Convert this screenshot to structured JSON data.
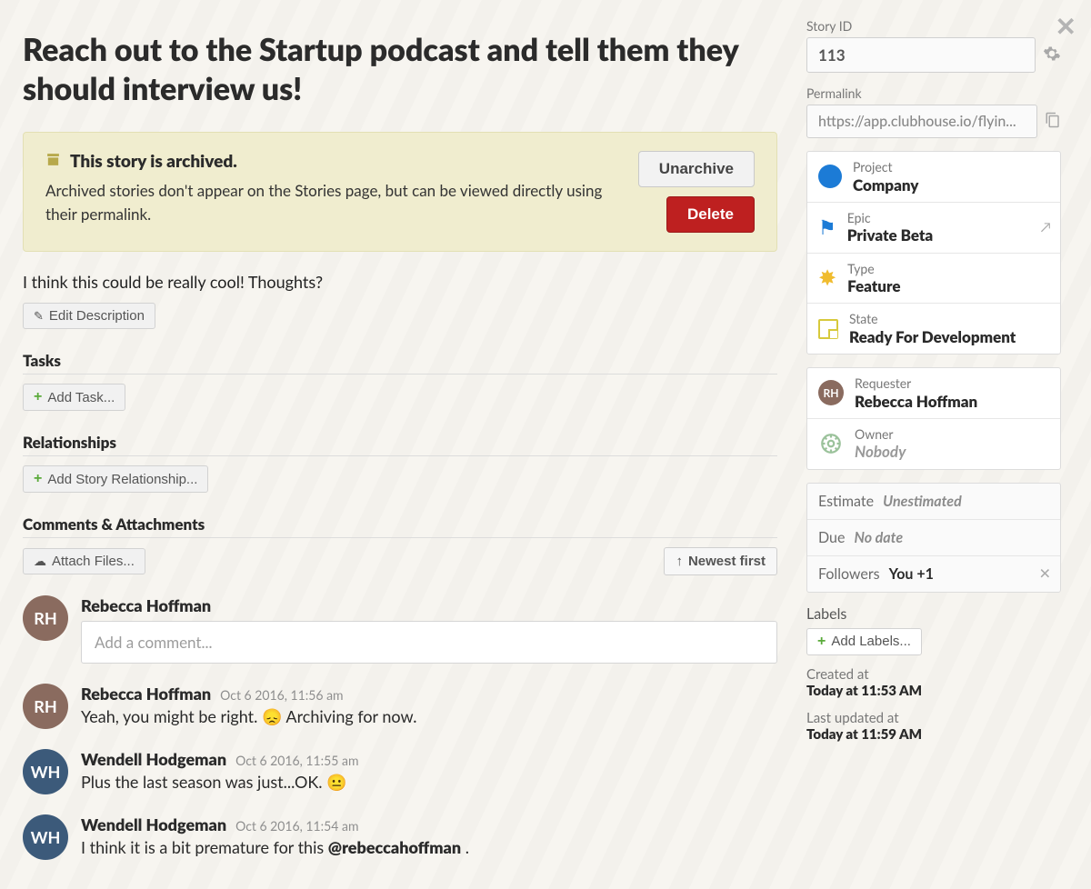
{
  "title": "Reach out to the Startup podcast and tell them they should interview us!",
  "archive": {
    "heading": "This story is archived.",
    "body": "Archived stories don't appear on the Stories page, but can be viewed directly using their permalink.",
    "unarchive_label": "Unarchive",
    "delete_label": "Delete"
  },
  "description": "I think this could be really cool! Thoughts?",
  "buttons": {
    "edit_description": "Edit Description",
    "add_task": "Add Task...",
    "add_relationship": "Add Story Relationship...",
    "attach_files": "Attach Files...",
    "sort": "Newest first",
    "add_labels": "Add Labels..."
  },
  "sections": {
    "tasks": "Tasks",
    "relationships": "Relationships",
    "comments": "Comments & Attachments",
    "labels": "Labels"
  },
  "composer": {
    "author": "Rebecca Hoffman",
    "placeholder": "Add a comment..."
  },
  "comments": [
    {
      "author": "Rebecca Hoffman",
      "timestamp": "Oct 6 2016, 11:56 am",
      "text_pre": "Yeah, you might be right. ",
      "emoji": "😞",
      "text_post": " Archiving for now.",
      "avatar": "woman"
    },
    {
      "author": "Wendell Hodgeman",
      "timestamp": "Oct 6 2016, 11:55 am",
      "text_pre": "Plus the last season was just...OK. ",
      "emoji": "😐",
      "text_post": "",
      "avatar": "man"
    },
    {
      "author": "Wendell Hodgeman",
      "timestamp": "Oct 6 2016, 11:54 am",
      "text_pre": "I think it is a bit premature for this ",
      "mention": "@rebeccahoffman",
      "text_post": " .",
      "avatar": "man"
    }
  ],
  "sidebar": {
    "story_id_label": "Story ID",
    "story_id": "113",
    "permalink_label": "Permalink",
    "permalink": "https://app.clubhouse.io/flyin...",
    "rows": {
      "project": {
        "k": "Project",
        "v": "Company"
      },
      "epic": {
        "k": "Epic",
        "v": "Private Beta"
      },
      "type": {
        "k": "Type",
        "v": "Feature"
      },
      "state": {
        "k": "State",
        "v": "Ready For Development"
      },
      "requester": {
        "k": "Requester",
        "v": "Rebecca Hoffman"
      },
      "owner": {
        "k": "Owner",
        "v": "Nobody"
      }
    },
    "flat": {
      "estimate": {
        "k": "Estimate",
        "v": "Unestimated"
      },
      "due": {
        "k": "Due",
        "v": "No date"
      },
      "followers": {
        "k": "Followers",
        "v": "You +1"
      }
    },
    "created": {
      "k": "Created at",
      "v": "Today at 11:53 AM"
    },
    "updated": {
      "k": "Last updated at",
      "v": "Today at 11:59 AM"
    }
  }
}
